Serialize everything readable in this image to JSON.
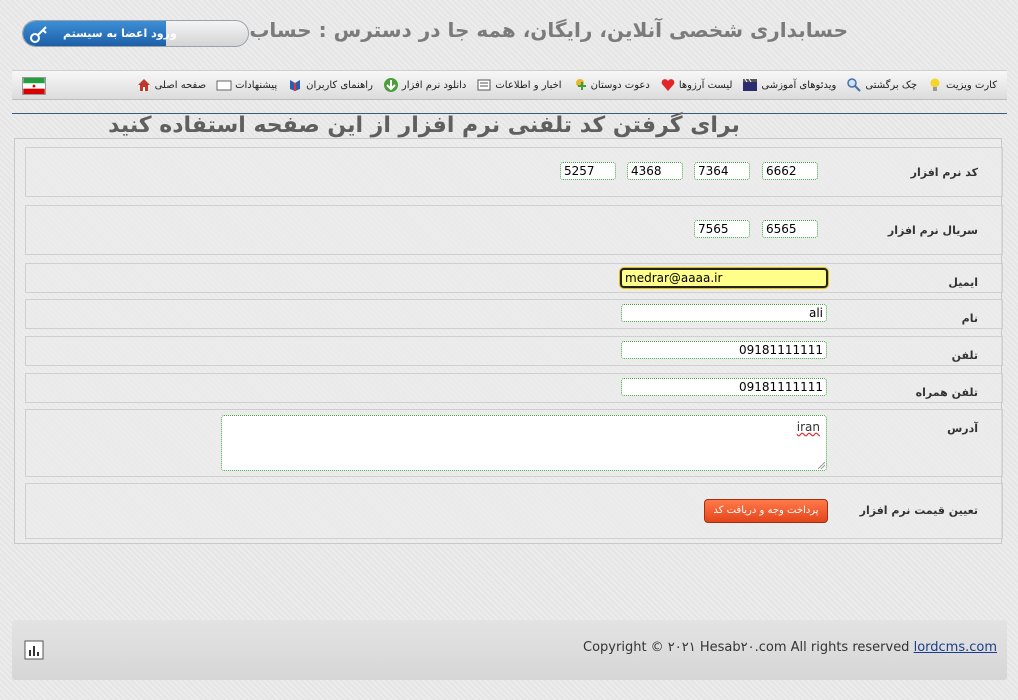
{
  "header": {
    "logo_text": "حساب بیست",
    "slogan": "حسابداری شخصی آنلاین، رایگان، همه جا در دسترس : حساب بیست",
    "login_button": "ورود اعضا به سیستم"
  },
  "nav": {
    "items": [
      {
        "label": "صفحه اصلی",
        "icon": "home-icon"
      },
      {
        "label": "پیشنهادات",
        "icon": "message-icon"
      },
      {
        "label": "راهنمای کاربران",
        "icon": "guide-icon"
      },
      {
        "label": "دانلود نرم افزار",
        "icon": "download-icon"
      },
      {
        "label": "اخبار و اطلاعات",
        "icon": "news-icon"
      },
      {
        "label": "دعوت دوستان",
        "icon": "invite-icon"
      },
      {
        "label": "لیست آرزوها",
        "icon": "wishlist-icon"
      },
      {
        "label": "ویدئوهای آموزشی",
        "icon": "video-icon"
      },
      {
        "label": "چک برگشتی",
        "icon": "search-icon"
      },
      {
        "label": "کارت ویزیت",
        "icon": "lightbulb-icon"
      }
    ],
    "flag": "iran-flag-icon"
  },
  "title": "برای گرفتن کد تلفنی نرم افزار از این صفحه استفاده کنید",
  "form": {
    "software_code_label": "کد نرم افزار",
    "software_code": [
      "6662",
      "7364",
      "4368",
      "5257"
    ],
    "serial_label": "سریال نرم افزار",
    "serial": [
      "6565",
      "7565"
    ],
    "email_label": "ایمیل",
    "email_value": "medrar@aaaa.ir",
    "name_label": "نام",
    "name_value": "ali",
    "phone_label": "تلفن",
    "phone_value": "09181111111",
    "mobile_label": "تلفن همراه",
    "mobile_value": "09181111111",
    "address_label": "آدرس",
    "address_value": "iran",
    "price_label": "تعیین قیمت نرم افزار",
    "pay_button": "پرداخت وجه و دریافت کد"
  },
  "footer": {
    "copyright_prefix": "Copyright © ۲۰۲۱ Hesab۲۰.com All rights reserved",
    "link": "lordcms.com"
  },
  "colors": {
    "accent": "#1d5fa7",
    "pay_button": "#e5451b",
    "focus_field": "#ffff8a",
    "divider": "#3d5a80"
  }
}
